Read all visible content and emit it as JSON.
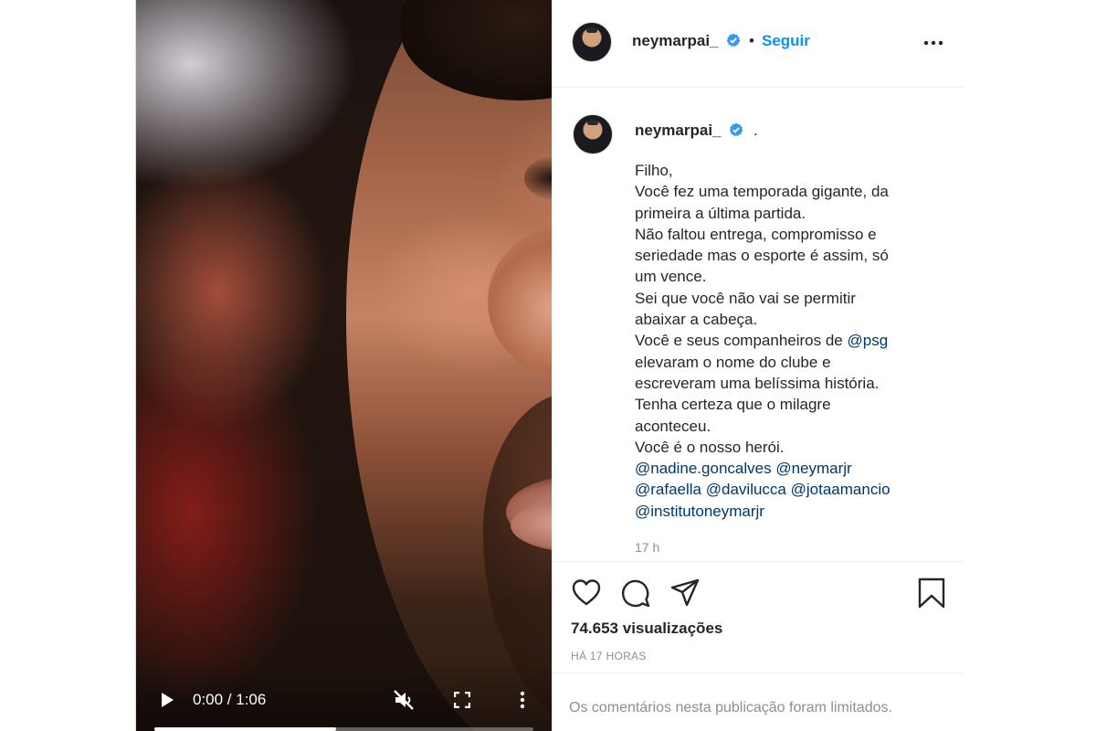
{
  "video": {
    "timecode": "0:00 / 1:06",
    "progress": 0.48
  },
  "header": {
    "username": "neymarpai_",
    "verified": true,
    "separator": "•",
    "follow_label": "Seguir"
  },
  "caption": {
    "username": "neymarpai_",
    "trailing": ".",
    "lines": [
      [
        {
          "t": "Filho,"
        }
      ],
      [
        {
          "t": "Você fez uma temporada gigante, da"
        }
      ],
      [
        {
          "t": "primeira a última partida."
        }
      ],
      [
        {
          "t": "Não faltou entrega, compromisso e"
        }
      ],
      [
        {
          "t": "seriedade mas o esporte é assim, só"
        }
      ],
      [
        {
          "t": "um vence."
        }
      ],
      [
        {
          "t": "Sei que você não vai se permitir"
        }
      ],
      [
        {
          "t": "abaixar a cabeça."
        }
      ],
      [
        {
          "t": "Você e seus companheiros de "
        },
        {
          "t": "@psg",
          "mention": true
        }
      ],
      [
        {
          "t": "elevaram o nome do clube e"
        }
      ],
      [
        {
          "t": "escreveram uma belíssima história."
        }
      ],
      [
        {
          "t": "Tenha certeza que o milagre"
        }
      ],
      [
        {
          "t": "aconteceu."
        }
      ],
      [
        {
          "t": "Você é o nosso herói."
        }
      ],
      [
        {
          "t": "@nadine.goncalves",
          "mention": true
        },
        {
          "t": " "
        },
        {
          "t": "@neymarjr",
          "mention": true
        }
      ],
      [
        {
          "t": "@rafaella",
          "mention": true
        },
        {
          "t": " "
        },
        {
          "t": "@davilucca",
          "mention": true
        },
        {
          "t": " "
        },
        {
          "t": "@jotaamancio",
          "mention": true
        }
      ],
      [
        {
          "t": "@institutoneymarjr",
          "mention": true
        }
      ]
    ],
    "time": "17 h"
  },
  "stats": {
    "views_count": "74.653",
    "views_label": "visualizações",
    "posted_ago": "HÁ 17 HORAS"
  },
  "comments": {
    "limited_text": "Os comentários nesta publicação foram limitados."
  },
  "icons": {
    "play": "play-icon",
    "mute": "muted-speaker-icon",
    "fullscreen": "fullscreen-icon",
    "more": "more-icon",
    "like": "heart-icon",
    "comment": "comment-icon",
    "share": "paper-plane-icon",
    "save": "bookmark-icon",
    "verified": "verified-badge-icon"
  },
  "colors": {
    "link_blue": "#0095f6",
    "mention_blue": "#00376b",
    "verified_blue": "#3897f0",
    "muted_text": "#8e8e8e"
  }
}
